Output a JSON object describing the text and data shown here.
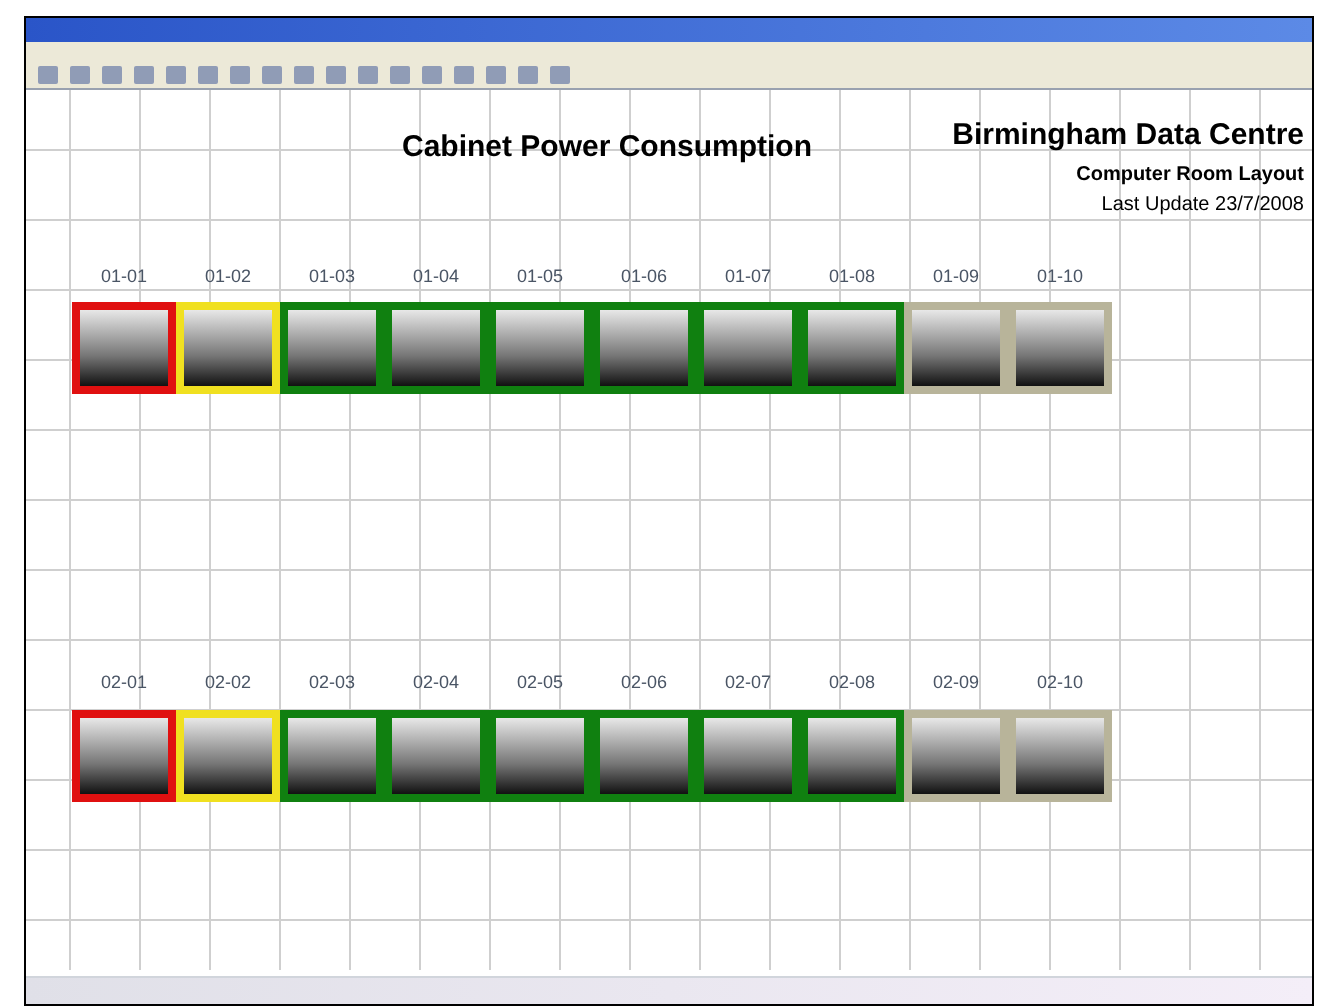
{
  "page": {
    "title": "Cabinet Power Consumption",
    "site": "Birmingham Data Centre",
    "subtitle": "Computer Room Layout",
    "updated": "Last Update 23/7/2008"
  },
  "rows": [
    {
      "cabinets": [
        {
          "label": "01-01",
          "color": "#e01010"
        },
        {
          "label": "01-02",
          "color": "#f0e020"
        },
        {
          "label": "01-03",
          "color": "#108010"
        },
        {
          "label": "01-04",
          "color": "#108010"
        },
        {
          "label": "01-05",
          "color": "#108010"
        },
        {
          "label": "01-06",
          "color": "#108010"
        },
        {
          "label": "01-07",
          "color": "#108010"
        },
        {
          "label": "01-08",
          "color": "#108010"
        },
        {
          "label": "01-09",
          "color": "#b8b49a"
        },
        {
          "label": "01-10",
          "color": "#b8b49a"
        }
      ]
    },
    {
      "cabinets": [
        {
          "label": "02-01",
          "color": "#e01010"
        },
        {
          "label": "02-02",
          "color": "#f0e020"
        },
        {
          "label": "02-03",
          "color": "#108010"
        },
        {
          "label": "02-04",
          "color": "#108010"
        },
        {
          "label": "02-05",
          "color": "#108010"
        },
        {
          "label": "02-06",
          "color": "#108010"
        },
        {
          "label": "02-07",
          "color": "#108010"
        },
        {
          "label": "02-08",
          "color": "#108010"
        },
        {
          "label": "02-09",
          "color": "#b8b49a"
        },
        {
          "label": "02-10",
          "color": "#b8b49a"
        }
      ]
    }
  ]
}
